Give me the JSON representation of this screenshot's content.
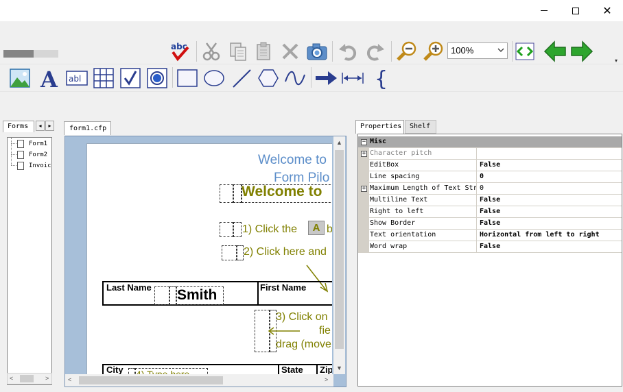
{
  "window": {
    "controls": {
      "minimize": "minimize",
      "maximize": "maximize",
      "close": "✕"
    }
  },
  "toolbar": {
    "zoom_value": "100%",
    "progress": 0.55,
    "icons_row1": [
      "spellcheck-icon",
      "cut-icon",
      "copy-icon",
      "paste-icon",
      "delete-icon",
      "camera-icon",
      "undo-icon",
      "redo-icon",
      "zoom-out-icon",
      "zoom-in-icon",
      "fit-width-icon",
      "back-arrow-icon",
      "forward-arrow-icon"
    ],
    "icons_row2": [
      "image-icon",
      "text-icon",
      "editbox-icon",
      "table-icon",
      "checkbox-icon",
      "radio-icon",
      "rectangle-icon",
      "ellipse-icon",
      "line-icon",
      "polygon-icon",
      "curve-icon",
      "arrow-icon",
      "dimension-icon",
      "brace-icon"
    ],
    "text_icon_glyph": "A",
    "editbox_icon_glyph": "abl",
    "brace_icon_glyph": "{"
  },
  "forms_panel": {
    "tab_label": "Forms",
    "items": [
      "Form1",
      "Form2",
      "Invoice"
    ]
  },
  "document": {
    "tab_label": "form1.cfp",
    "welcome_line1": "Welcome to",
    "welcome_line2": "Form Pilo",
    "heading": "Welcome to",
    "step1_prefix": "1) Click the",
    "step1_icon": "A",
    "step1_suffix": "b",
    "step2": "2) Click here and",
    "last_name_label": "Last Name",
    "last_name_value": "Smith",
    "first_name_label": "First Name",
    "step3_line1": "3) Click on",
    "step3_line2": "fie",
    "step3_line3": "drag (move",
    "city_label": "City",
    "step4": "4) Type here",
    "state_label": "State",
    "zip_label": "Zip"
  },
  "properties": {
    "tabs": [
      "Properties",
      "Shelf"
    ],
    "category": "Misc",
    "rows": [
      {
        "name": "Character pitch",
        "value": "",
        "expandable": true,
        "muted": true
      },
      {
        "name": "EditBox",
        "value": "False",
        "expandable": false
      },
      {
        "name": "Line spacing",
        "value": "0",
        "expandable": false
      },
      {
        "name": "Maximum Length of Text Str",
        "value": "0",
        "expandable": true,
        "plainValue": true
      },
      {
        "name": "Multiline Text",
        "value": "False",
        "expandable": false
      },
      {
        "name": "Right to left",
        "value": "False",
        "expandable": false
      },
      {
        "name": "Show Border",
        "value": "False",
        "expandable": false
      },
      {
        "name": "Text orientation",
        "value": "Horizontal from left to right",
        "expandable": false
      },
      {
        "name": "Word wrap",
        "value": "False",
        "expandable": false
      }
    ]
  },
  "colors": {
    "accent_blue": "#5b8dc9",
    "olive": "#808000",
    "green_arrow": "#2e9e2e",
    "doc_background": "#a7bfd9"
  }
}
